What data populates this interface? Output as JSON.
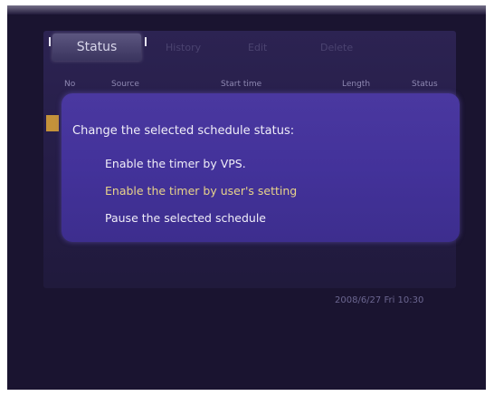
{
  "tabs": [
    {
      "label": "Status",
      "active": true
    },
    {
      "label": "History",
      "active": false
    },
    {
      "label": "Edit",
      "active": false
    },
    {
      "label": "Delete",
      "active": false
    }
  ],
  "columns": [
    "No",
    "Source",
    "Start time",
    "Length",
    "Status"
  ],
  "dialog": {
    "title": "Change the selected schedule status:",
    "options": [
      {
        "label": "Enable the timer by VPS.",
        "selected": false
      },
      {
        "label": "Enable the timer by user's setting",
        "selected": true
      },
      {
        "label": "Pause the selected schedule",
        "selected": false
      }
    ]
  },
  "footer": {
    "datetime": "2008/6/27 Fri 10:30"
  },
  "colors": {
    "background": "#1a1430",
    "dialog": "#43329a",
    "selected_text": "#e8d38a",
    "row_highlight": "#c4923a"
  }
}
